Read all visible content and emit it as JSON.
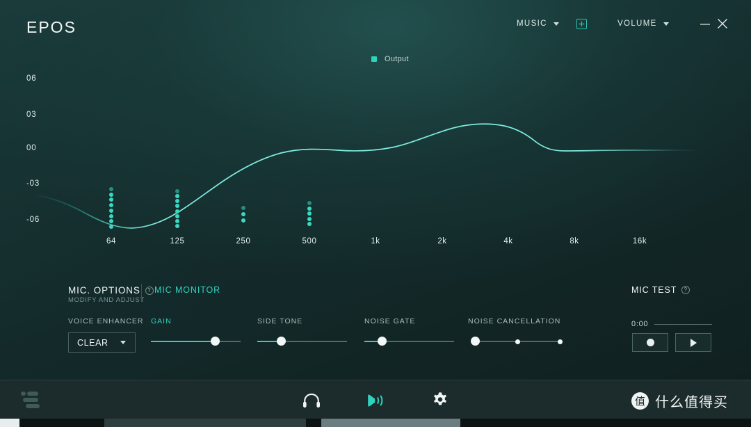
{
  "app": {
    "brand": "EPOS",
    "background_top": "#1b3d3c",
    "background_bottom": "#101f1f",
    "accent": "#2ed3bd"
  },
  "topbar": {
    "preset_label": "MUSIC",
    "add_preset_icon": "plus-box-icon",
    "volume_label": "VOLUME",
    "minimize_icon": "minimize-icon",
    "close_icon": "close-icon"
  },
  "equalizer": {
    "legend_label": "Output",
    "legend_color": "#2ed3bd",
    "y_labels": [
      "06",
      "03",
      "00",
      "-03",
      "-06"
    ],
    "x_labels": [
      "64",
      "125",
      "250",
      "500",
      "1k",
      "2k",
      "4k",
      "8k",
      "16k"
    ]
  },
  "chart_data": {
    "type": "line",
    "title": "",
    "xlabel": "",
    "ylabel": "",
    "legend": [
      "Output"
    ],
    "legend_position": "top-center",
    "grid": false,
    "xlim": [
      20,
      20000
    ],
    "ylim": [
      -7.5,
      7.5
    ],
    "x_tick_labels": [
      "64",
      "125",
      "250",
      "500",
      "1k",
      "2k",
      "4k",
      "8k",
      "16k"
    ],
    "y_tick_labels": [
      "06",
      "03",
      "00",
      "-03",
      "-06"
    ],
    "y_tick_values": [
      6,
      3,
      0,
      -3,
      -6
    ],
    "series": [
      {
        "name": "Output",
        "x": [
          "32",
          "45",
          "64",
          "90",
          "125",
          "180",
          "250",
          "355",
          "500",
          "710",
          "1k",
          "1.4k",
          "2k",
          "2.8k",
          "4k",
          "5.6k",
          "8k",
          "11k",
          "16k",
          "20k"
        ],
        "values": [
          -4.2,
          -5.7,
          -6.4,
          -6.7,
          -6.1,
          -4.9,
          -3.3,
          -1.6,
          -0.5,
          0.0,
          0.1,
          0.3,
          0.7,
          1.5,
          2.1,
          1.5,
          0.0,
          -0.2,
          -0.1,
          -0.1
        ]
      }
    ],
    "band_markers": [
      {
        "freq": "64",
        "dots": 8,
        "gain": -6.3
      },
      {
        "freq": "125",
        "dots": 8,
        "gain": -6.0
      },
      {
        "freq": "250",
        "dots": 3,
        "gain": -3.2
      },
      {
        "freq": "500",
        "dots": 5,
        "gain": -4.1
      }
    ]
  },
  "mic_panel": {
    "title": "MIC. OPTIONS",
    "title_help_icon": "question-mark-icon",
    "subtitle": "MODIFY AND ADJUST",
    "mic_monitor_label": "MIC MONITOR",
    "mic_test_label": "MIC TEST",
    "mic_test_help_icon": "question-mark-icon",
    "controls": [
      {
        "name": "voice-enhancer",
        "label": "VOICE ENHANCER",
        "type": "select",
        "value": "CLEAR",
        "active": false
      },
      {
        "name": "gain",
        "label": "GAIN",
        "type": "slider",
        "value_pct": 72,
        "active": true
      },
      {
        "name": "side-tone",
        "label": "SIDE TONE",
        "type": "slider",
        "value_pct": 27,
        "active": false
      },
      {
        "name": "noise-gate",
        "label": "NOISE GATE",
        "type": "slider",
        "value_pct": 20,
        "active": false
      },
      {
        "name": "noise-cancellation",
        "label": "NOISE CANCELLATION",
        "type": "step-slider",
        "steps": 3,
        "selected_step": 1,
        "active": false
      }
    ],
    "mic_test": {
      "time": "0:00",
      "record_icon": "record-circle-icon",
      "play_icon": "play-triangle-icon"
    }
  },
  "bottombar": {
    "brand_mark_icon": "epos-bars-icon",
    "nav": [
      {
        "name": "headset",
        "icon": "headphones-icon",
        "active": false
      },
      {
        "name": "microphone",
        "icon": "mic-waves-icon",
        "active": true
      },
      {
        "name": "settings",
        "icon": "gear-icon",
        "active": false
      }
    ]
  },
  "watermark": {
    "badge": "值",
    "text": "什么值得买"
  }
}
